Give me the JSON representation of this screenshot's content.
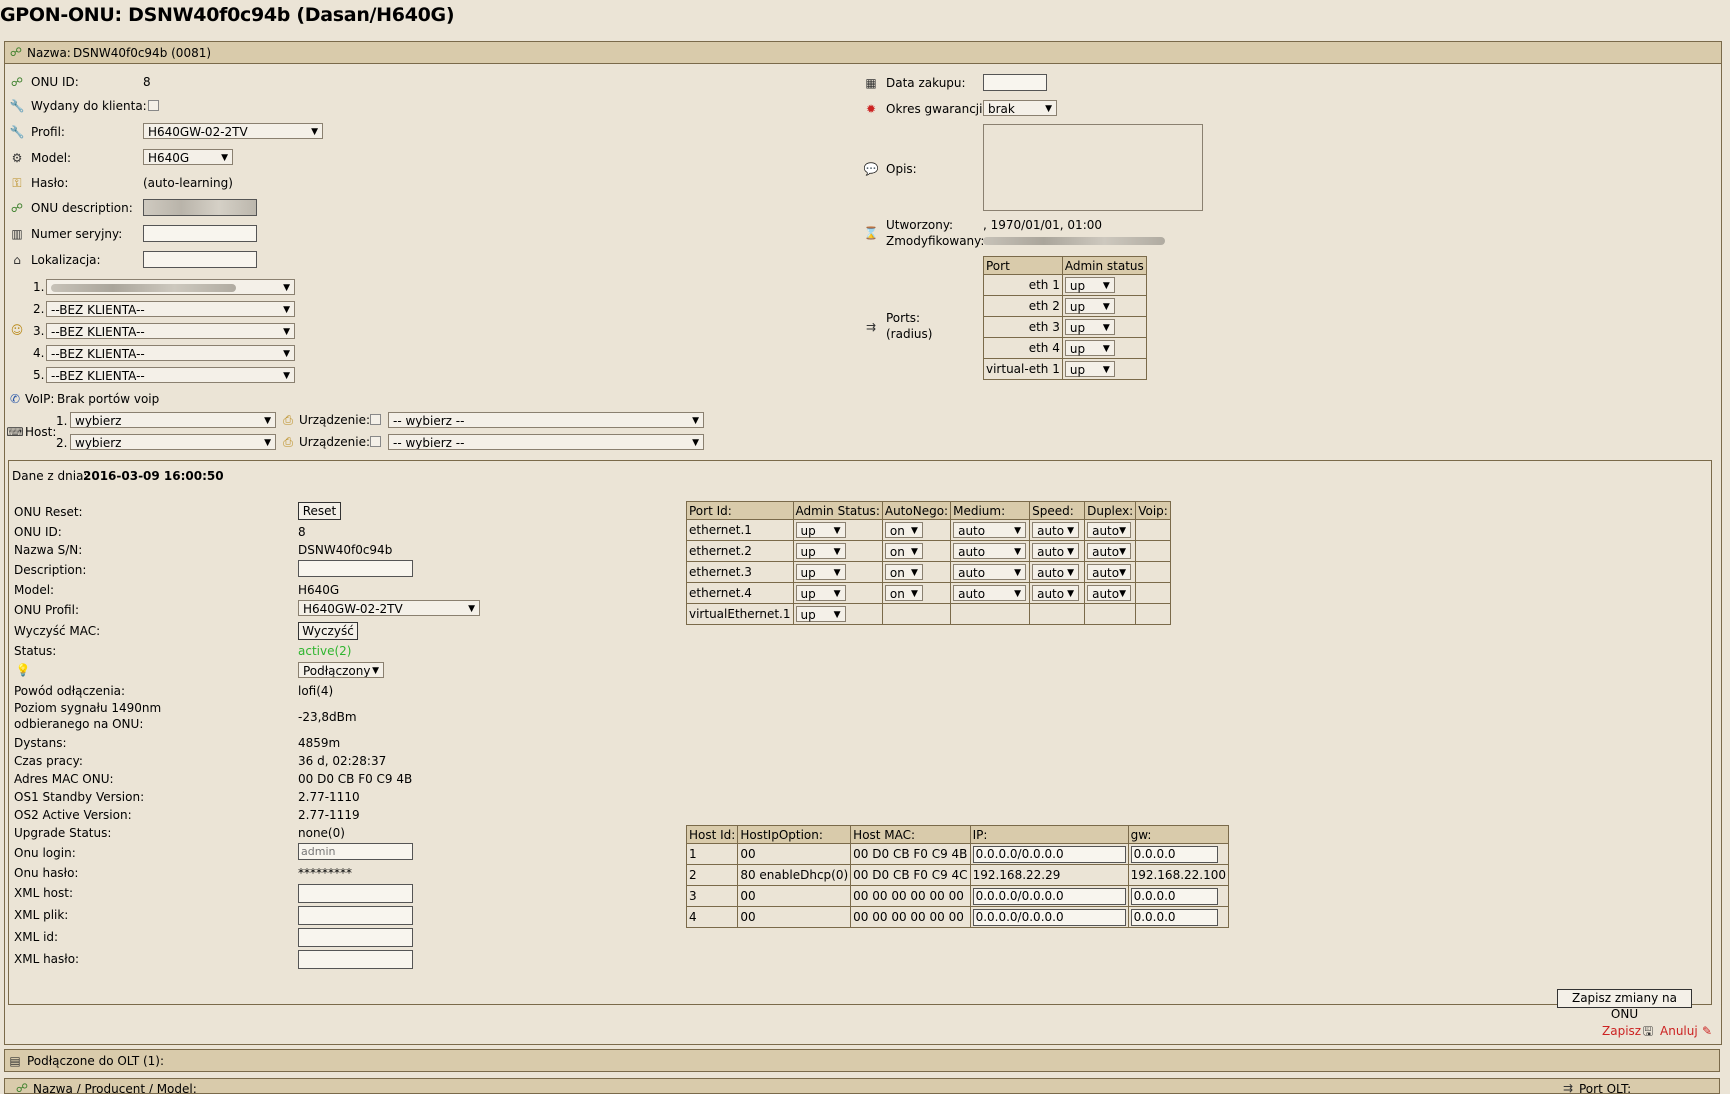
{
  "page": {
    "title": "GPON-ONU: DSNW40f0c94b (Dasan/H640G)"
  },
  "header": {
    "name_label": "Nazwa:",
    "name_value": "DSNW40f0c94b (0081)"
  },
  "left": {
    "onu_id_label": "ONU ID:",
    "onu_id_value": "8",
    "issued_label": "Wydany do klienta:",
    "profile_label": "Profil:",
    "profile_value": "H640GW-02-2TV",
    "model_label": "Model:",
    "model_value": "H640G",
    "password_label": "Hasło:",
    "password_value": "(auto-learning)",
    "onu_desc_label": "ONU description:",
    "serial_label": "Numer seryjny:",
    "location_label": "Lokalizacja:",
    "clients": [
      {
        "num": "1.",
        "value": ""
      },
      {
        "num": "2.",
        "value": "--BEZ KLIENTA--"
      },
      {
        "num": "3.",
        "value": "--BEZ KLIENTA--"
      },
      {
        "num": "4.",
        "value": "--BEZ KLIENTA--"
      },
      {
        "num": "5.",
        "value": "--BEZ KLIENTA--"
      }
    ],
    "voip_label": "VoIP:",
    "voip_value": "Brak portów voip",
    "host_label": "Host:",
    "hosts": [
      {
        "num": "1.",
        "value": "wybierz",
        "device_label": "Urządzenie:",
        "device_value": "-- wybierz --"
      },
      {
        "num": "2.",
        "value": "wybierz",
        "device_label": "Urządzenie:",
        "device_value": "-- wybierz --"
      }
    ]
  },
  "right": {
    "purchase_label": "Data zakupu:",
    "warranty_label": "Okres gwarancji:",
    "warranty_value": "brak",
    "desc_label": "Opis:",
    "created_label": "Utworzony:",
    "created_value": ", 1970/01/01, 01:00",
    "modified_label": "Zmodyfikowany:",
    "ports_label": "Ports:",
    "ports_sub": "(radius)",
    "ports_headers": [
      "Port",
      "Admin status"
    ],
    "ports": [
      {
        "port": "eth 1",
        "status": "up"
      },
      {
        "port": "eth 2",
        "status": "up"
      },
      {
        "port": "eth 3",
        "status": "up"
      },
      {
        "port": "eth 4",
        "status": "up"
      },
      {
        "port": "virtual-eth 1",
        "status": "up"
      }
    ]
  },
  "data": {
    "date_label": "Dane z dnia:",
    "date_value": "2016-03-09 16:00:50",
    "reset_label": "ONU Reset:",
    "reset_button": "Reset",
    "onu_id_label": "ONU ID:",
    "onu_id_value": "8",
    "sn_label": "Nazwa S/N:",
    "sn_value": "DSNW40f0c94b",
    "description_label": "Description:",
    "model_label": "Model:",
    "model_value": "H640G",
    "profile_label": "ONU Profil:",
    "profile_value": "H640GW-02-2TV",
    "clear_mac_label": "Wyczyść MAC:",
    "clear_mac_button": "Wyczyść",
    "status_label": "Status:",
    "status_value": "active(2)",
    "connected_value": "Podłączony",
    "disconnect_label": "Powód odłączenia:",
    "disconnect_value": "lofi(4)",
    "signal_label_1": "Poziom sygnału 1490nm",
    "signal_label_2": "odbieranego na ONU:",
    "signal_value": "-23,8dBm",
    "distance_label": "Dystans:",
    "distance_value": "4859m",
    "uptime_label": "Czas pracy:",
    "uptime_value": "36 d, 02:28:37",
    "mac_label": "Adres MAC ONU:",
    "mac_value": "00 D0 CB F0 C9 4B",
    "os1_label": "OS1 Standby Version:",
    "os1_value": "2.77-1110",
    "os2_label": "OS2 Active Version:",
    "os2_value": "2.77-1119",
    "upgrade_label": "Upgrade Status:",
    "upgrade_value": "none(0)",
    "login_label": "Onu login:",
    "login_value": "admin",
    "pass_label": "Onu hasło:",
    "pass_value": "*********",
    "xml_host_label": "XML host:",
    "xml_file_label": "XML plik:",
    "xml_id_label": "XML id:",
    "xml_pass_label": "XML hasło:",
    "save_onu_button": "Zapisz zmiany na ONU"
  },
  "eth_table": {
    "headers": [
      "Port Id:",
      "Admin Status:",
      "AutoNego:",
      "Medium:",
      "Speed:",
      "Duplex:",
      "Voip:"
    ],
    "rows": [
      {
        "port": "ethernet.1",
        "admin": "up",
        "auto": "on",
        "medium": "auto",
        "speed": "auto",
        "duplex": "auto"
      },
      {
        "port": "ethernet.2",
        "admin": "up",
        "auto": "on",
        "medium": "auto",
        "speed": "auto",
        "duplex": "auto"
      },
      {
        "port": "ethernet.3",
        "admin": "up",
        "auto": "on",
        "medium": "auto",
        "speed": "auto",
        "duplex": "auto"
      },
      {
        "port": "ethernet.4",
        "admin": "up",
        "auto": "on",
        "medium": "auto",
        "speed": "auto",
        "duplex": "auto"
      },
      {
        "port": "virtualEthernet.1",
        "admin": "up"
      }
    ]
  },
  "host_table": {
    "headers": [
      "Host Id:",
      "HostIpOption:",
      "Host MAC:",
      "IP:",
      "gw:"
    ],
    "rows": [
      {
        "id": "1",
        "opt": "00",
        "mac": "00 D0 CB F0 C9 4B",
        "ip": "0.0.0.0/0.0.0.0",
        "gw": "0.0.0.0"
      },
      {
        "id": "2",
        "opt": "80 enableDhcp(0)",
        "mac": "00 D0 CB F0 C9 4C",
        "ip": "192.168.22.29",
        "gw": "192.168.22.100"
      },
      {
        "id": "3",
        "opt": "00",
        "mac": "00 00 00 00 00 00",
        "ip": "0.0.0.0/0.0.0.0",
        "gw": "0.0.0.0"
      },
      {
        "id": "4",
        "opt": "00",
        "mac": "00 00 00 00 00 00",
        "ip": "0.0.0.0/0.0.0.0",
        "gw": "0.0.0.0"
      }
    ]
  },
  "footer": {
    "save": "Zapisz",
    "cancel": "Anuluj"
  },
  "olt": {
    "title": "Podłączone do OLT (1):",
    "col_name": "Nazwa / Producent / Model:",
    "col_port": "Port OLT:"
  }
}
